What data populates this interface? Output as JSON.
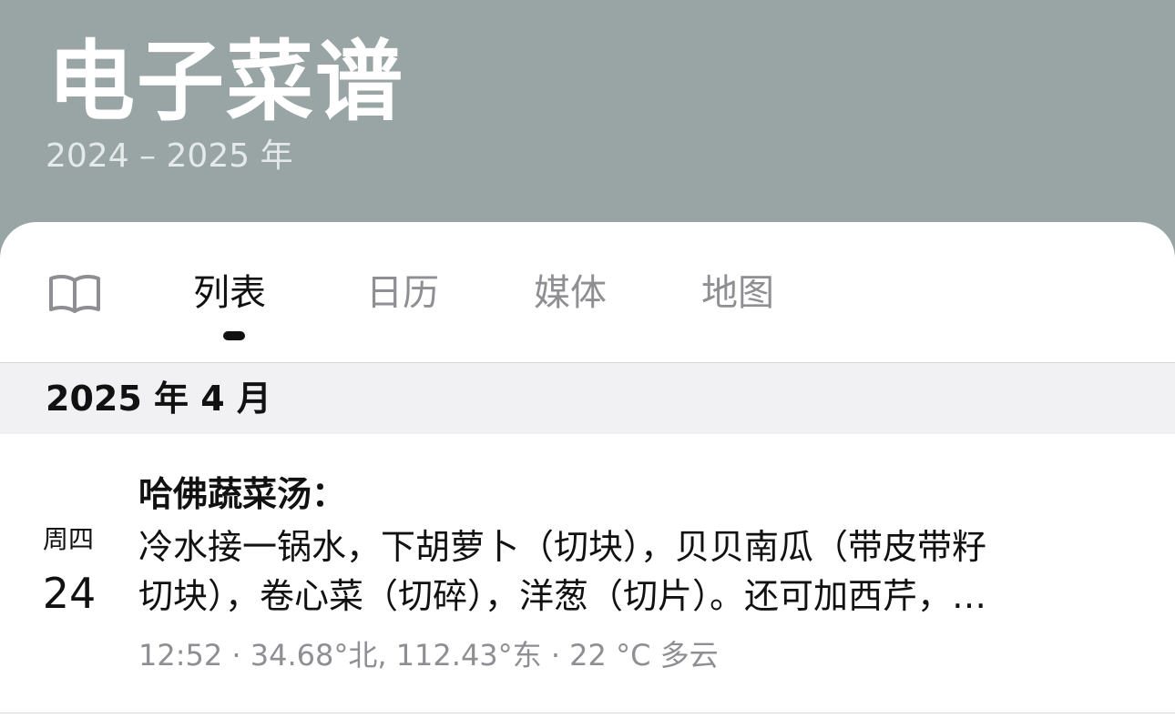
{
  "header": {
    "title": "电子菜谱",
    "subtitle": "2024 – 2025 年"
  },
  "tabs": {
    "book_icon": "book-icon",
    "items": [
      {
        "label": "列表",
        "active": true
      },
      {
        "label": "日历",
        "active": false
      },
      {
        "label": "媒体",
        "active": false
      },
      {
        "label": "地图",
        "active": false
      }
    ]
  },
  "section": {
    "title": "2025 年 4 月"
  },
  "entry": {
    "weekday": "周四",
    "day": "24",
    "title": "哈佛蔬菜汤：",
    "line1": "冷水接一锅水，下胡萝卜（切块），贝贝南瓜（带皮带籽",
    "line2": "切块），卷心菜（切碎），洋葱（切片）。还可加西芹，…",
    "meta": "12:52 · 34.68°北, 112.43°东 · 22 °C 多云"
  },
  "colors": {
    "header_bg": "#99a4a5",
    "section_bg": "#f1f1f4",
    "inactive_tab": "#8e8e93",
    "text": "#111111"
  }
}
